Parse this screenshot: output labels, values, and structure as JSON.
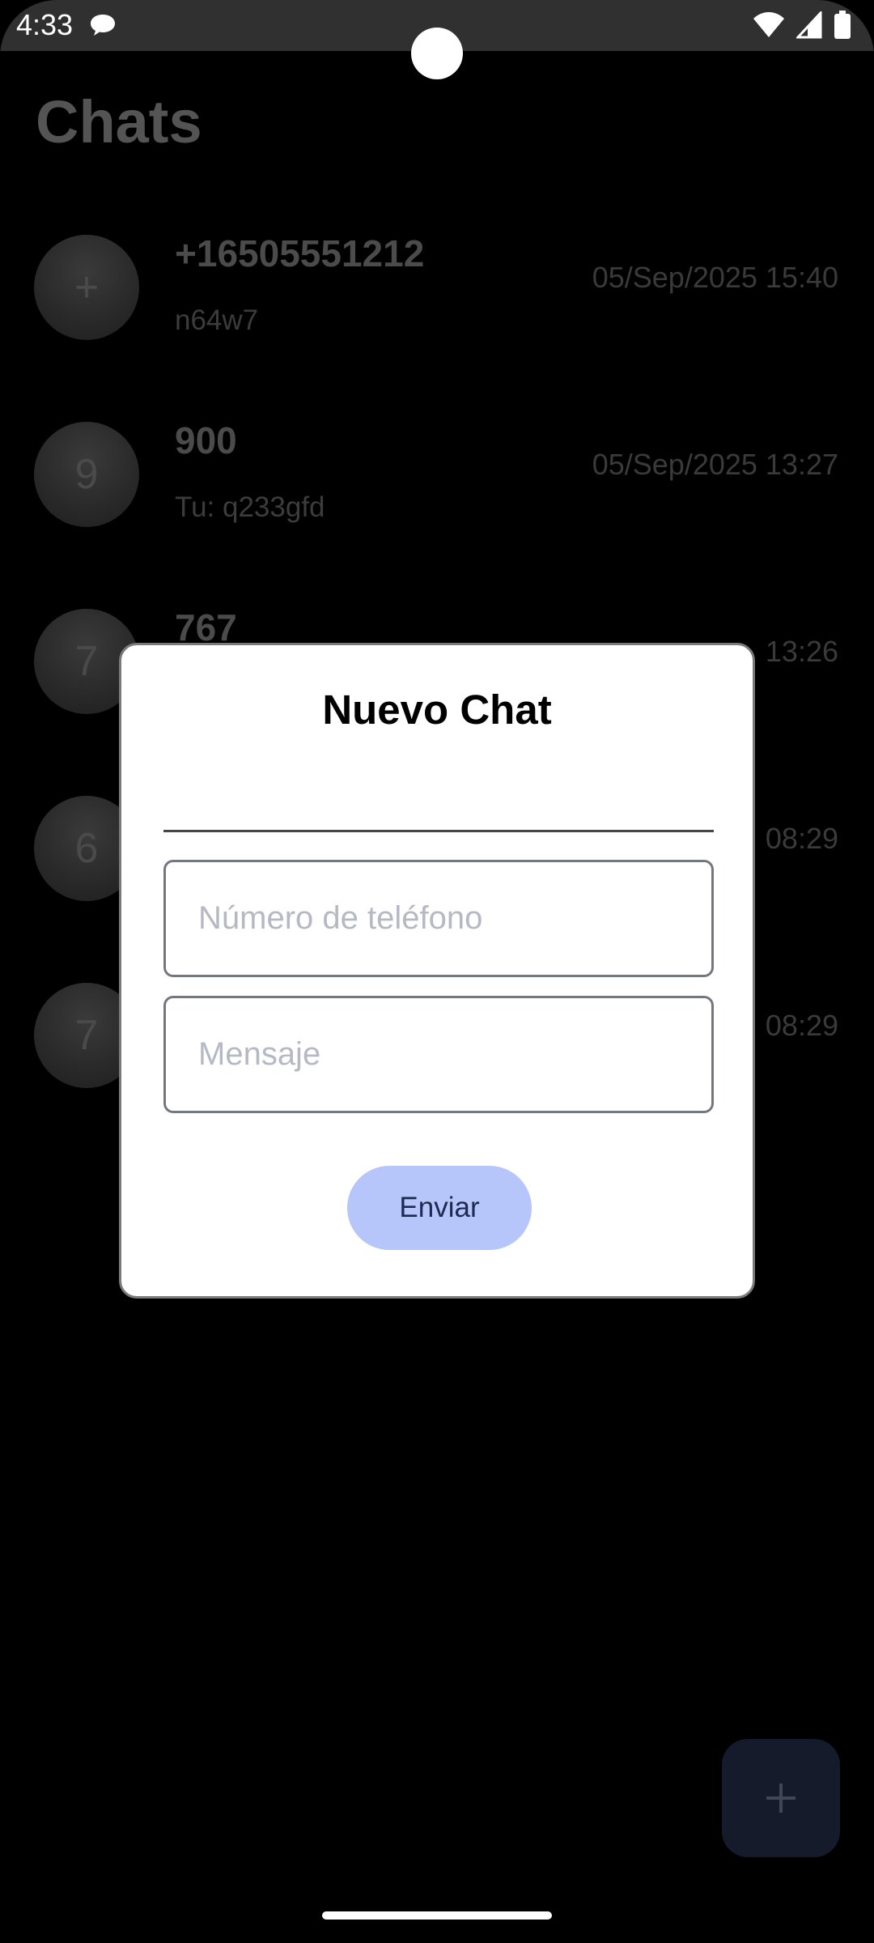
{
  "status_bar": {
    "time": "4:33",
    "icons": [
      "chat-bubble-notification-icon",
      "wifi-icon",
      "cellular-signal-icon",
      "battery-icon"
    ]
  },
  "app": {
    "title": "Chats"
  },
  "chats": [
    {
      "avatar": "+",
      "name": "+16505551212",
      "preview": "n64w7",
      "date": "05/Sep/2025 15:40"
    },
    {
      "avatar": "9",
      "name": "900",
      "preview": "Tu: q233gfd",
      "date": "05/Sep/2025 13:27"
    },
    {
      "avatar": "7",
      "name": "767",
      "preview": "",
      "date": "13:26"
    },
    {
      "avatar": "6",
      "name": "",
      "preview": "",
      "date": "08:29"
    },
    {
      "avatar": "7",
      "name": "",
      "preview": "",
      "date": "08:29"
    }
  ],
  "dialog": {
    "title": "Nuevo Chat",
    "top_field_value": "",
    "phone_placeholder": "Número de teléfono",
    "phone_value": "",
    "message_placeholder": "Mensaje",
    "message_value": "",
    "send_label": "Enviar"
  },
  "fab": {
    "icon": "plus-icon"
  },
  "colors": {
    "send_button_bg": "#b6c5fa",
    "fab_bg": "#151b2a",
    "status_bar_bg": "#303030"
  }
}
